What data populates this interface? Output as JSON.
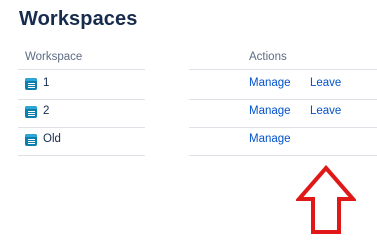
{
  "page": {
    "title": "Workspaces"
  },
  "table": {
    "columns": {
      "workspace": "Workspace",
      "actions": "Actions"
    },
    "rows": [
      {
        "name": "1",
        "actions": [
          "Manage",
          "Leave"
        ]
      },
      {
        "name": "2",
        "actions": [
          "Manage",
          "Leave"
        ]
      },
      {
        "name": "Old",
        "actions": [
          "Manage"
        ]
      }
    ]
  },
  "icons": {
    "workspace": "workspace-icon",
    "annotation": "up-arrow-icon"
  },
  "colors": {
    "link": "#0052cc",
    "icon": "#0b7fae",
    "annotation_arrow": "#e01818",
    "divider": "#dfe1e6"
  }
}
